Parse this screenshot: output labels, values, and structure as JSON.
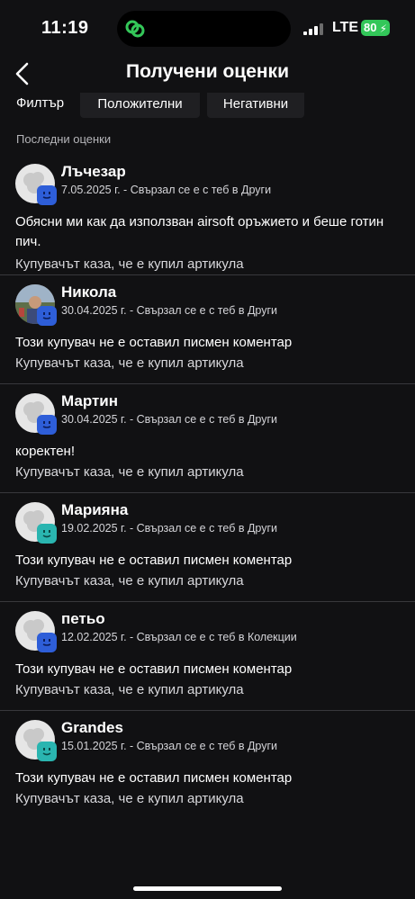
{
  "status": {
    "time": "11:19",
    "network": "LTE",
    "battery": "80"
  },
  "header": {
    "title": "Получени оценки"
  },
  "filter": {
    "label": "Филтър",
    "positive": "Положителни",
    "negative": "Негативни"
  },
  "section": {
    "heading": "Последни оценки"
  },
  "colors": {
    "background": "#111113",
    "badge_blue": "#2e5ed8",
    "badge_teal": "#2ab5b0",
    "battery": "#33c759"
  },
  "reviews": [
    {
      "name": "Лъчезар",
      "meta": "7.05.2025 г. - Свързал се е с теб в Други",
      "comment": "Обясни ми как да използван airsoft оръжието и беше готин пич.",
      "buyer": "Купувачът каза, че е купил артикула",
      "badge": "badge-blue-icon"
    },
    {
      "name": "Никола",
      "meta": "30.04.2025 г. - Свързал се е с теб в Други",
      "comment": "Този купувач не е оставил писмен коментар",
      "buyer": "Купувачът каза, че е купил артикула",
      "badge": "badge-blue-icon"
    },
    {
      "name": "Мартин",
      "meta": "30.04.2025 г. - Свързал се е с теб в Други",
      "comment": "коректен!",
      "buyer": "Купувачът каза, че е купил артикула",
      "badge": "badge-blue-icon"
    },
    {
      "name": "Марияна",
      "meta": "19.02.2025 г. - Свързал се е с теб в Други",
      "comment": "Този купувач не е оставил писмен коментар",
      "buyer": "Купувачът каза, че е купил артикула",
      "badge": "badge-teal-icon"
    },
    {
      "name": "петьо",
      "meta": "12.02.2025 г. - Свързал се е с теб в Колекции",
      "comment": "Този купувач не е оставил писмен коментар",
      "buyer": "Купувачът каза, че е купил артикула",
      "badge": "badge-blue-icon"
    },
    {
      "name": "Grandes",
      "meta": "15.01.2025 г. - Свързал се е с теб в Други",
      "comment": "Този купувач не е оставил писмен коментар",
      "buyer": "Купувачът каза, че е купил артикула",
      "badge": "badge-teal-icon"
    }
  ]
}
